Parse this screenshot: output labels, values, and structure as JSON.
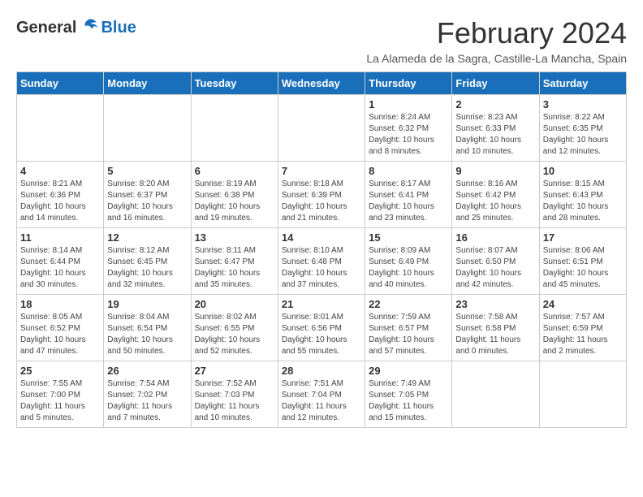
{
  "header": {
    "logo": {
      "general": "General",
      "blue": "Blue"
    },
    "title": "February 2024",
    "location": "La Alameda de la Sagra, Castille-La Mancha, Spain"
  },
  "calendar": {
    "days_of_week": [
      "Sunday",
      "Monday",
      "Tuesday",
      "Wednesday",
      "Thursday",
      "Friday",
      "Saturday"
    ],
    "weeks": [
      [
        {
          "day": "",
          "info": ""
        },
        {
          "day": "",
          "info": ""
        },
        {
          "day": "",
          "info": ""
        },
        {
          "day": "",
          "info": ""
        },
        {
          "day": "1",
          "info": "Sunrise: 8:24 AM\nSunset: 6:32 PM\nDaylight: 10 hours\nand 8 minutes."
        },
        {
          "day": "2",
          "info": "Sunrise: 8:23 AM\nSunset: 6:33 PM\nDaylight: 10 hours\nand 10 minutes."
        },
        {
          "day": "3",
          "info": "Sunrise: 8:22 AM\nSunset: 6:35 PM\nDaylight: 10 hours\nand 12 minutes."
        }
      ],
      [
        {
          "day": "4",
          "info": "Sunrise: 8:21 AM\nSunset: 6:36 PM\nDaylight: 10 hours\nand 14 minutes."
        },
        {
          "day": "5",
          "info": "Sunrise: 8:20 AM\nSunset: 6:37 PM\nDaylight: 10 hours\nand 16 minutes."
        },
        {
          "day": "6",
          "info": "Sunrise: 8:19 AM\nSunset: 6:38 PM\nDaylight: 10 hours\nand 19 minutes."
        },
        {
          "day": "7",
          "info": "Sunrise: 8:18 AM\nSunset: 6:39 PM\nDaylight: 10 hours\nand 21 minutes."
        },
        {
          "day": "8",
          "info": "Sunrise: 8:17 AM\nSunset: 6:41 PM\nDaylight: 10 hours\nand 23 minutes."
        },
        {
          "day": "9",
          "info": "Sunrise: 8:16 AM\nSunset: 6:42 PM\nDaylight: 10 hours\nand 25 minutes."
        },
        {
          "day": "10",
          "info": "Sunrise: 8:15 AM\nSunset: 6:43 PM\nDaylight: 10 hours\nand 28 minutes."
        }
      ],
      [
        {
          "day": "11",
          "info": "Sunrise: 8:14 AM\nSunset: 6:44 PM\nDaylight: 10 hours\nand 30 minutes."
        },
        {
          "day": "12",
          "info": "Sunrise: 8:12 AM\nSunset: 6:45 PM\nDaylight: 10 hours\nand 32 minutes."
        },
        {
          "day": "13",
          "info": "Sunrise: 8:11 AM\nSunset: 6:47 PM\nDaylight: 10 hours\nand 35 minutes."
        },
        {
          "day": "14",
          "info": "Sunrise: 8:10 AM\nSunset: 6:48 PM\nDaylight: 10 hours\nand 37 minutes."
        },
        {
          "day": "15",
          "info": "Sunrise: 8:09 AM\nSunset: 6:49 PM\nDaylight: 10 hours\nand 40 minutes."
        },
        {
          "day": "16",
          "info": "Sunrise: 8:07 AM\nSunset: 6:50 PM\nDaylight: 10 hours\nand 42 minutes."
        },
        {
          "day": "17",
          "info": "Sunrise: 8:06 AM\nSunset: 6:51 PM\nDaylight: 10 hours\nand 45 minutes."
        }
      ],
      [
        {
          "day": "18",
          "info": "Sunrise: 8:05 AM\nSunset: 6:52 PM\nDaylight: 10 hours\nand 47 minutes."
        },
        {
          "day": "19",
          "info": "Sunrise: 8:04 AM\nSunset: 6:54 PM\nDaylight: 10 hours\nand 50 minutes."
        },
        {
          "day": "20",
          "info": "Sunrise: 8:02 AM\nSunset: 6:55 PM\nDaylight: 10 hours\nand 52 minutes."
        },
        {
          "day": "21",
          "info": "Sunrise: 8:01 AM\nSunset: 6:56 PM\nDaylight: 10 hours\nand 55 minutes."
        },
        {
          "day": "22",
          "info": "Sunrise: 7:59 AM\nSunset: 6:57 PM\nDaylight: 10 hours\nand 57 minutes."
        },
        {
          "day": "23",
          "info": "Sunrise: 7:58 AM\nSunset: 6:58 PM\nDaylight: 11 hours\nand 0 minutes."
        },
        {
          "day": "24",
          "info": "Sunrise: 7:57 AM\nSunset: 6:59 PM\nDaylight: 11 hours\nand 2 minutes."
        }
      ],
      [
        {
          "day": "25",
          "info": "Sunrise: 7:55 AM\nSunset: 7:00 PM\nDaylight: 11 hours\nand 5 minutes."
        },
        {
          "day": "26",
          "info": "Sunrise: 7:54 AM\nSunset: 7:02 PM\nDaylight: 11 hours\nand 7 minutes."
        },
        {
          "day": "27",
          "info": "Sunrise: 7:52 AM\nSunset: 7:03 PM\nDaylight: 11 hours\nand 10 minutes."
        },
        {
          "day": "28",
          "info": "Sunrise: 7:51 AM\nSunset: 7:04 PM\nDaylight: 11 hours\nand 12 minutes."
        },
        {
          "day": "29",
          "info": "Sunrise: 7:49 AM\nSunset: 7:05 PM\nDaylight: 11 hours\nand 15 minutes."
        },
        {
          "day": "",
          "info": ""
        },
        {
          "day": "",
          "info": ""
        }
      ]
    ]
  }
}
